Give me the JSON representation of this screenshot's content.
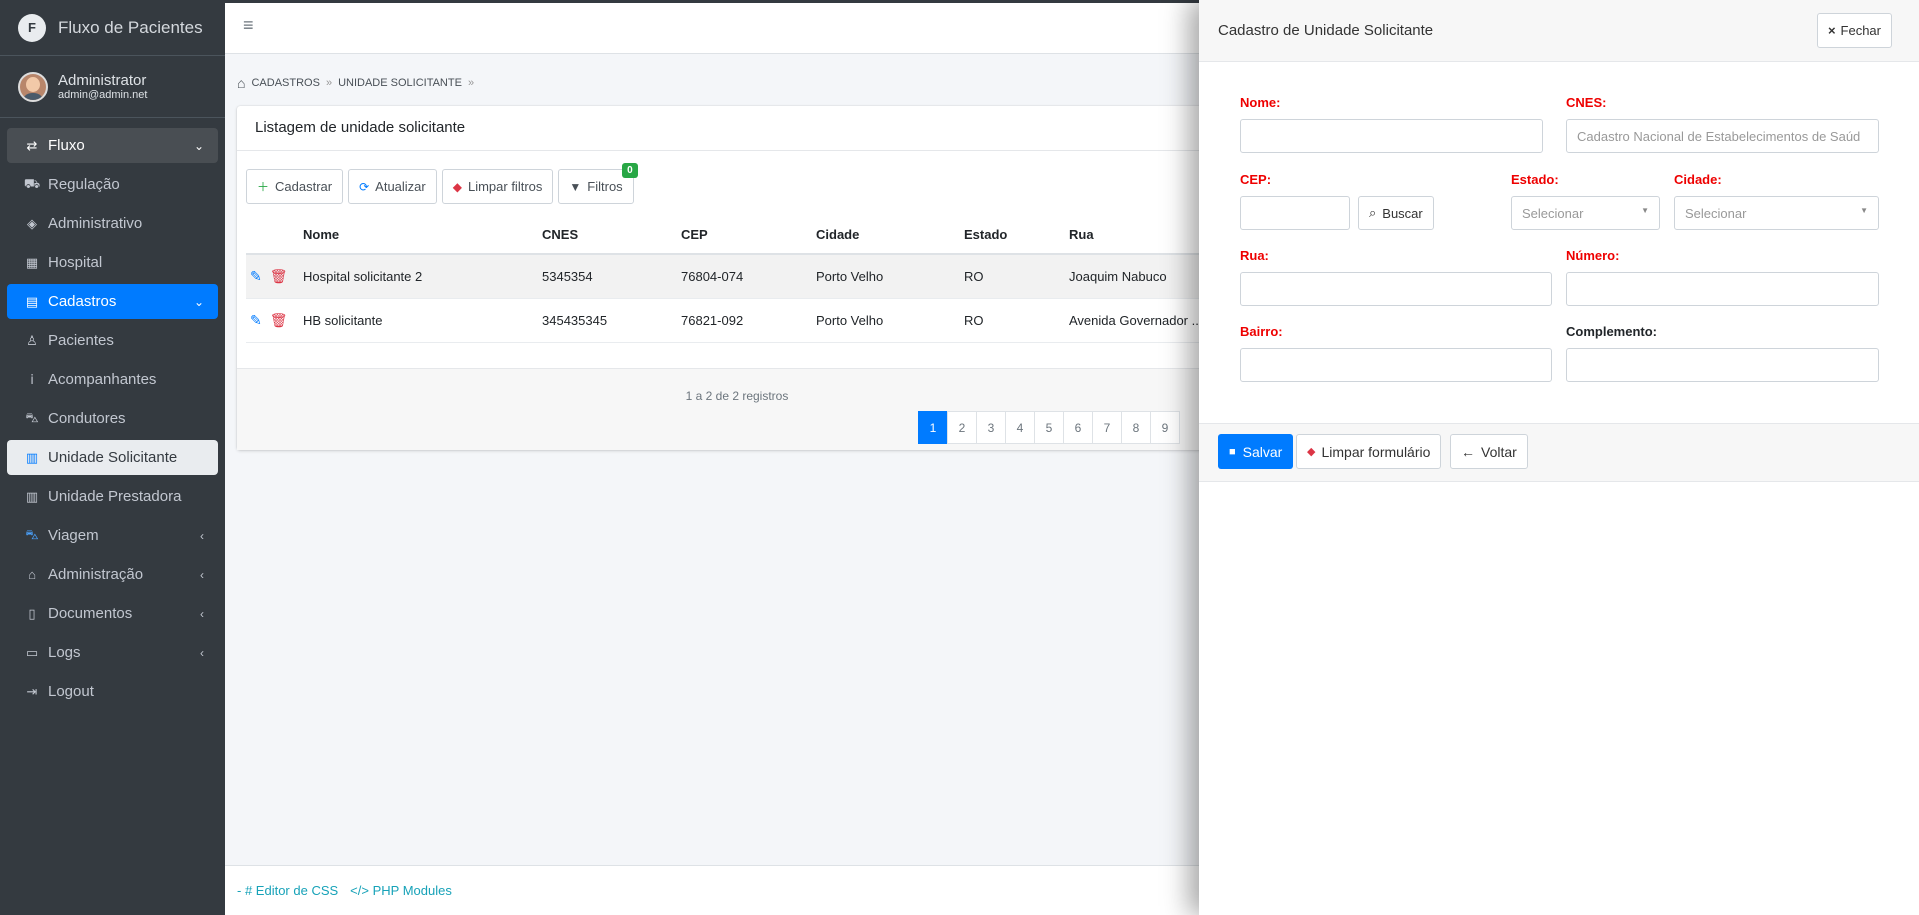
{
  "brand": {
    "logo_letter": "F",
    "title": "Fluxo de Pacientes"
  },
  "user": {
    "name": "Administrator",
    "email": "admin@admin.net"
  },
  "sidebar": {
    "items": [
      {
        "label": "Fluxo",
        "icon": "exchange-icon"
      },
      {
        "label": "Regulação",
        "icon": "ambulance-icon"
      },
      {
        "label": "Administrativo",
        "icon": "layers-icon"
      },
      {
        "label": "Hospital",
        "icon": "hospital-icon"
      },
      {
        "label": "Cadastros",
        "icon": "id-card-icon"
      },
      {
        "label": "Pacientes",
        "icon": "user-icon"
      },
      {
        "label": "Acompanhantes",
        "icon": "person-icon"
      },
      {
        "label": "Condutores",
        "icon": "car-icon"
      },
      {
        "label": "Unidade Solicitante",
        "icon": "building-icon"
      },
      {
        "label": "Unidade Prestadora",
        "icon": "building-icon"
      },
      {
        "label": "Viagem",
        "icon": "car-icon"
      },
      {
        "label": "Administração",
        "icon": "home-icon"
      },
      {
        "label": "Documentos",
        "icon": "file-icon"
      },
      {
        "label": "Logs",
        "icon": "monitor-icon"
      },
      {
        "label": "Logout",
        "icon": "sign-out-icon"
      }
    ]
  },
  "breadcrumb": {
    "home": "CADASTROS",
    "current": "UNIDADE SOLICITANTE"
  },
  "list": {
    "title": "Listagem de unidade solicitante",
    "toolbar": {
      "create": "Cadastrar",
      "refresh": "Atualizar",
      "clear_filters": "Limpar filtros",
      "filters": "Filtros",
      "filters_count": "0"
    },
    "columns": [
      "Nome",
      "CNES",
      "CEP",
      "Cidade",
      "Estado",
      "Rua"
    ],
    "rows": [
      [
        "Hospital solicitante 2",
        "5345354",
        "76804-074",
        "Porto Velho",
        "RO",
        "Joaquim Nabuco"
      ],
      [
        "HB solicitante",
        "345435345",
        "76821-092",
        "Porto Velho",
        "RO",
        "Avenida Governador ..."
      ]
    ],
    "records": "1 a 2 de 2 registros",
    "pages": [
      "1",
      "2",
      "3",
      "4",
      "5",
      "6",
      "7",
      "8",
      "9"
    ]
  },
  "footer": {
    "css_editor": "Editor de CSS",
    "php_modules": "PHP Modules"
  },
  "drawer": {
    "title": "Cadastro de Unidade Solicitante",
    "close": "Fechar",
    "fields": {
      "nome": {
        "label": "Nome:",
        "value": ""
      },
      "cnes": {
        "label": "CNES:",
        "placeholder": "Cadastro Nacional de Estabelecimentos de Saúd"
      },
      "cep": {
        "label": "CEP:",
        "value": ""
      },
      "buscar": "Buscar",
      "estado": {
        "label": "Estado:",
        "selected": "Selecionar"
      },
      "cidade": {
        "label": "Cidade:",
        "selected": "Selecionar"
      },
      "rua": {
        "label": "Rua:",
        "value": ""
      },
      "numero": {
        "label": "Número:",
        "value": ""
      },
      "bairro": {
        "label": "Bairro:",
        "value": ""
      },
      "complemento": {
        "label": "Complemento:",
        "value": ""
      }
    },
    "actions": {
      "save": "Salvar",
      "clear": "Limpar formulário",
      "back": "Voltar"
    }
  },
  "colors": {
    "primary": "#007bff",
    "sidebar_bg": "#343a40",
    "danger": "#dc3545",
    "required_label": "#ee0000",
    "badge": "#28a745"
  }
}
